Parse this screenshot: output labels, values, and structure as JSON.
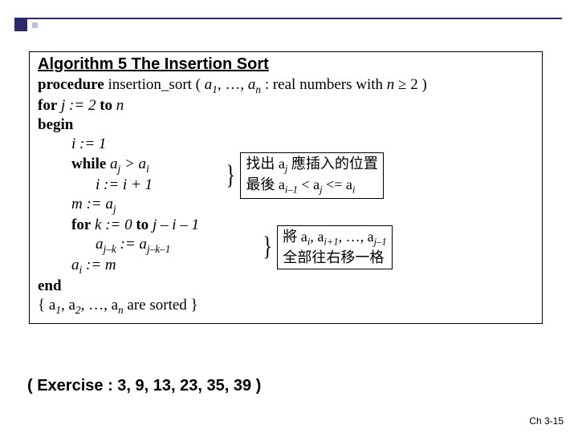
{
  "accent": {
    "square_color": "#2a2a6a",
    "dot_color": "#b6c4d8"
  },
  "algo": {
    "title": "Algorithm 5  The Insertion Sort",
    "proc_kw": "procedure",
    "proc_rest_a": " insertion_sort ( ",
    "proc_rest_b": ", …, ",
    "proc_rest_c": " : real numbers with ",
    "proc_rest_d": " ≥ 2 )",
    "a1": "a",
    "a1_sub": "1",
    "an": "a",
    "an_sub": "n",
    "nvar": "n",
    "for_kw": "for",
    "for_rest_a": "  j := 2 ",
    "to_kw": "to",
    "for_rest_b": " n",
    "begin_kw": "begin",
    "l_i1": "i := 1",
    "while_kw": "while",
    "while_rest_a": "  a",
    "while_sub_j": "j",
    "while_gt": " > a",
    "while_sub_i": "i",
    "l_iinc": "i := i + 1",
    "l_m": "m := a",
    "l_m_sub": "j",
    "for2_kw": "for",
    "for2_rest_a": " k := 0  ",
    "to2_kw": "to",
    "for2_rest_b": "  j – i – 1",
    "l_shift_a": "a",
    "l_shift_sub1": "j–k",
    "l_shift_mid": " := a",
    "l_shift_sub2": "j–k–1",
    "l_ai": "a",
    "l_ai_sub": "i",
    "l_ai_rest": " := m",
    "end_kw": "end",
    "comment_a": "{ a",
    "comment_s1": "1",
    "comment_b": ", a",
    "comment_s2": "2",
    "comment_c": ", …, a",
    "comment_sn": "n",
    "comment_d": " are sorted }"
  },
  "annot1": {
    "line1_a": "找出 a",
    "line1_sub": "j",
    "line1_b": " 應插入的位置",
    "line2_a": "最後 a",
    "line2_sub1": "i–1",
    "line2_b": " < a",
    "line2_sub2": "j",
    "line2_c": " <= a",
    "line2_sub3": "i"
  },
  "annot2": {
    "line1_a": "將 a",
    "line1_s1": "i",
    "line1_b": ", a",
    "line1_s2": "i+1",
    "line1_c": ", …, a",
    "line1_s3": "j–1",
    "line2": "全部往右移一格"
  },
  "exercise": "( Exercise : 3, 9, 13, 23, 35, 39 )",
  "footer": "Ch 3-15"
}
